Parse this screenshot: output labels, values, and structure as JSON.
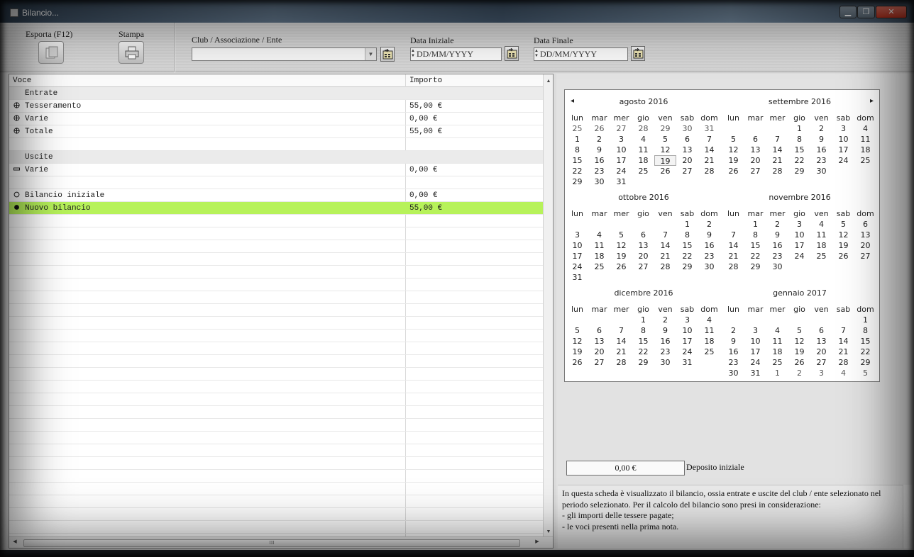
{
  "window": {
    "title": "Bilancio..."
  },
  "toolbar": {
    "export_label": "Esporta (F12)",
    "print_label": "Stampa",
    "club_label": "Club / Associazione / Ente",
    "club_value": "",
    "start_date_label": "Data Iniziale",
    "start_date_value": "DD/MM/YYYY",
    "end_date_label": "Data Finale",
    "end_date_value": "DD/MM/YYYY"
  },
  "table": {
    "headers": {
      "voce": "Voce",
      "importo": "Importo"
    },
    "rows": [
      {
        "voce": "Entrate",
        "importo": "",
        "marker": "",
        "type": "section"
      },
      {
        "voce": "Tesseramento",
        "importo": "55,00 €",
        "marker": "plus",
        "type": "item"
      },
      {
        "voce": "Varie",
        "importo": "0,00 €",
        "marker": "plus",
        "type": "item"
      },
      {
        "voce": "Totale",
        "importo": "55,00 €",
        "marker": "plus",
        "type": "item"
      },
      {
        "voce": "",
        "importo": "",
        "marker": "",
        "type": "blank"
      },
      {
        "voce": "Uscite",
        "importo": "",
        "marker": "",
        "type": "section"
      },
      {
        "voce": "Varie",
        "importo": "0,00 €",
        "marker": "minus",
        "type": "item"
      },
      {
        "voce": "",
        "importo": "",
        "marker": "",
        "type": "blank"
      },
      {
        "voce": "Bilancio iniziale",
        "importo": "0,00 €",
        "marker": "circle",
        "type": "item"
      },
      {
        "voce": "Nuovo bilancio",
        "importo": "55,00 €",
        "marker": "dot",
        "type": "highlight"
      }
    ],
    "scroll_thumb_label": "III"
  },
  "calendar": {
    "weekdays": [
      "lun",
      "mar",
      "mer",
      "gio",
      "ven",
      "sab",
      "dom"
    ],
    "months": [
      {
        "title": "agosto 2016",
        "lead": 0,
        "days": 31,
        "prev_tail": [
          25,
          26,
          27,
          28,
          29,
          30,
          31
        ],
        "next_head": [],
        "today": 19
      },
      {
        "title": "settembre 2016",
        "lead": 3,
        "days": 30,
        "prev_tail": [],
        "next_head": [],
        "today": 0
      },
      {
        "title": "ottobre 2016",
        "lead": 5,
        "days": 31,
        "prev_tail": [],
        "next_head": [],
        "today": 0
      },
      {
        "title": "novembre 2016",
        "lead": 1,
        "days": 30,
        "prev_tail": [],
        "next_head": [],
        "today": 0
      },
      {
        "title": "dicembre 2016",
        "lead": 3,
        "days": 31,
        "prev_tail": [],
        "next_head": [],
        "today": 0
      },
      {
        "title": "gennaio 2017",
        "lead": 6,
        "days": 31,
        "prev_tail": [],
        "next_head": [
          1,
          2,
          3,
          4,
          5
        ],
        "today": 0
      }
    ],
    "prev_arrow": "◂",
    "next_arrow": "▸"
  },
  "deposit": {
    "value": "0,00 €",
    "label": "Deposito iniziale"
  },
  "info": {
    "line1": "In questa scheda è visualizzato il bilancio, ossia entrate e uscite del club / ente selezionato nel periodo selezionato. Per il calcolo del bilancio sono presi in considerazione:",
    "line2": "- gli importi delle tessere pagate;",
    "line3": "- le voci presenti nella prima nota."
  },
  "colors": {
    "highlight": "#b7f25a",
    "section": "#ebebeb"
  }
}
